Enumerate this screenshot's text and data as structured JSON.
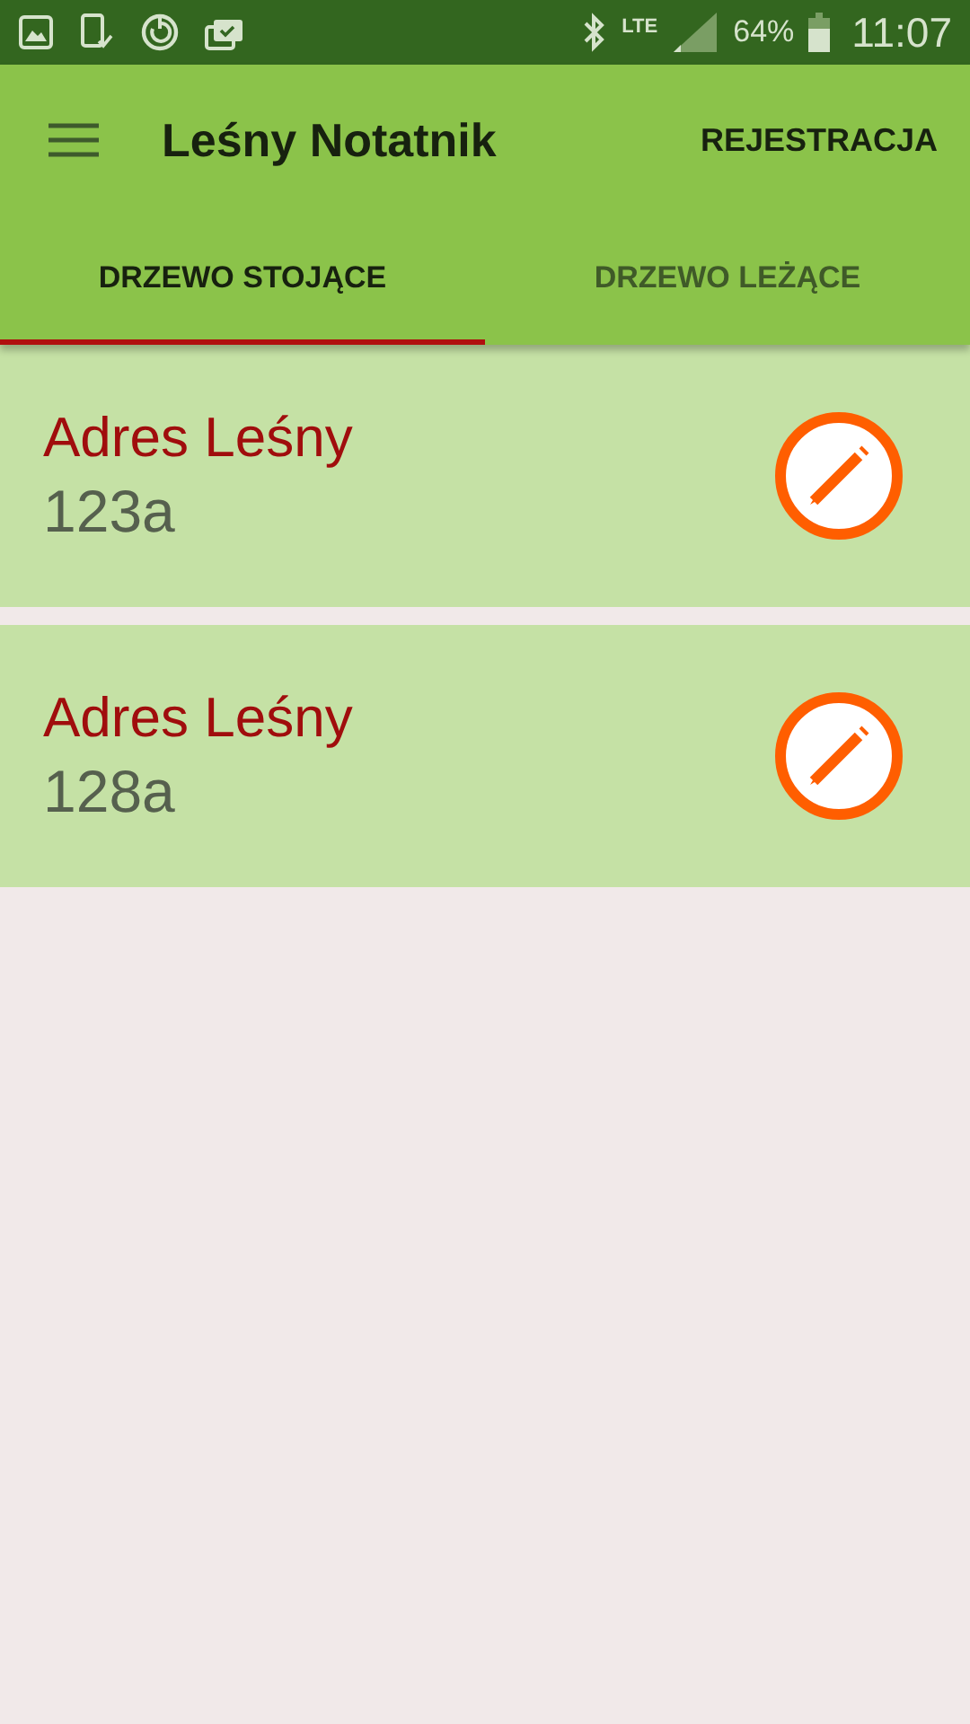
{
  "status_bar": {
    "network": "LTE",
    "battery": "64%",
    "time": "11:07"
  },
  "app_bar": {
    "title": "Leśny Notatnik",
    "action": "REJESTRACJA"
  },
  "tabs": [
    {
      "label": "DRZEWO STOJĄCE",
      "selected": true
    },
    {
      "label": "DRZEWO LEŻĄCE",
      "selected": false
    }
  ],
  "items": [
    {
      "title": "Adres Leśny",
      "subtitle": "123a"
    },
    {
      "title": "Adres Leśny",
      "subtitle": "128a"
    }
  ]
}
